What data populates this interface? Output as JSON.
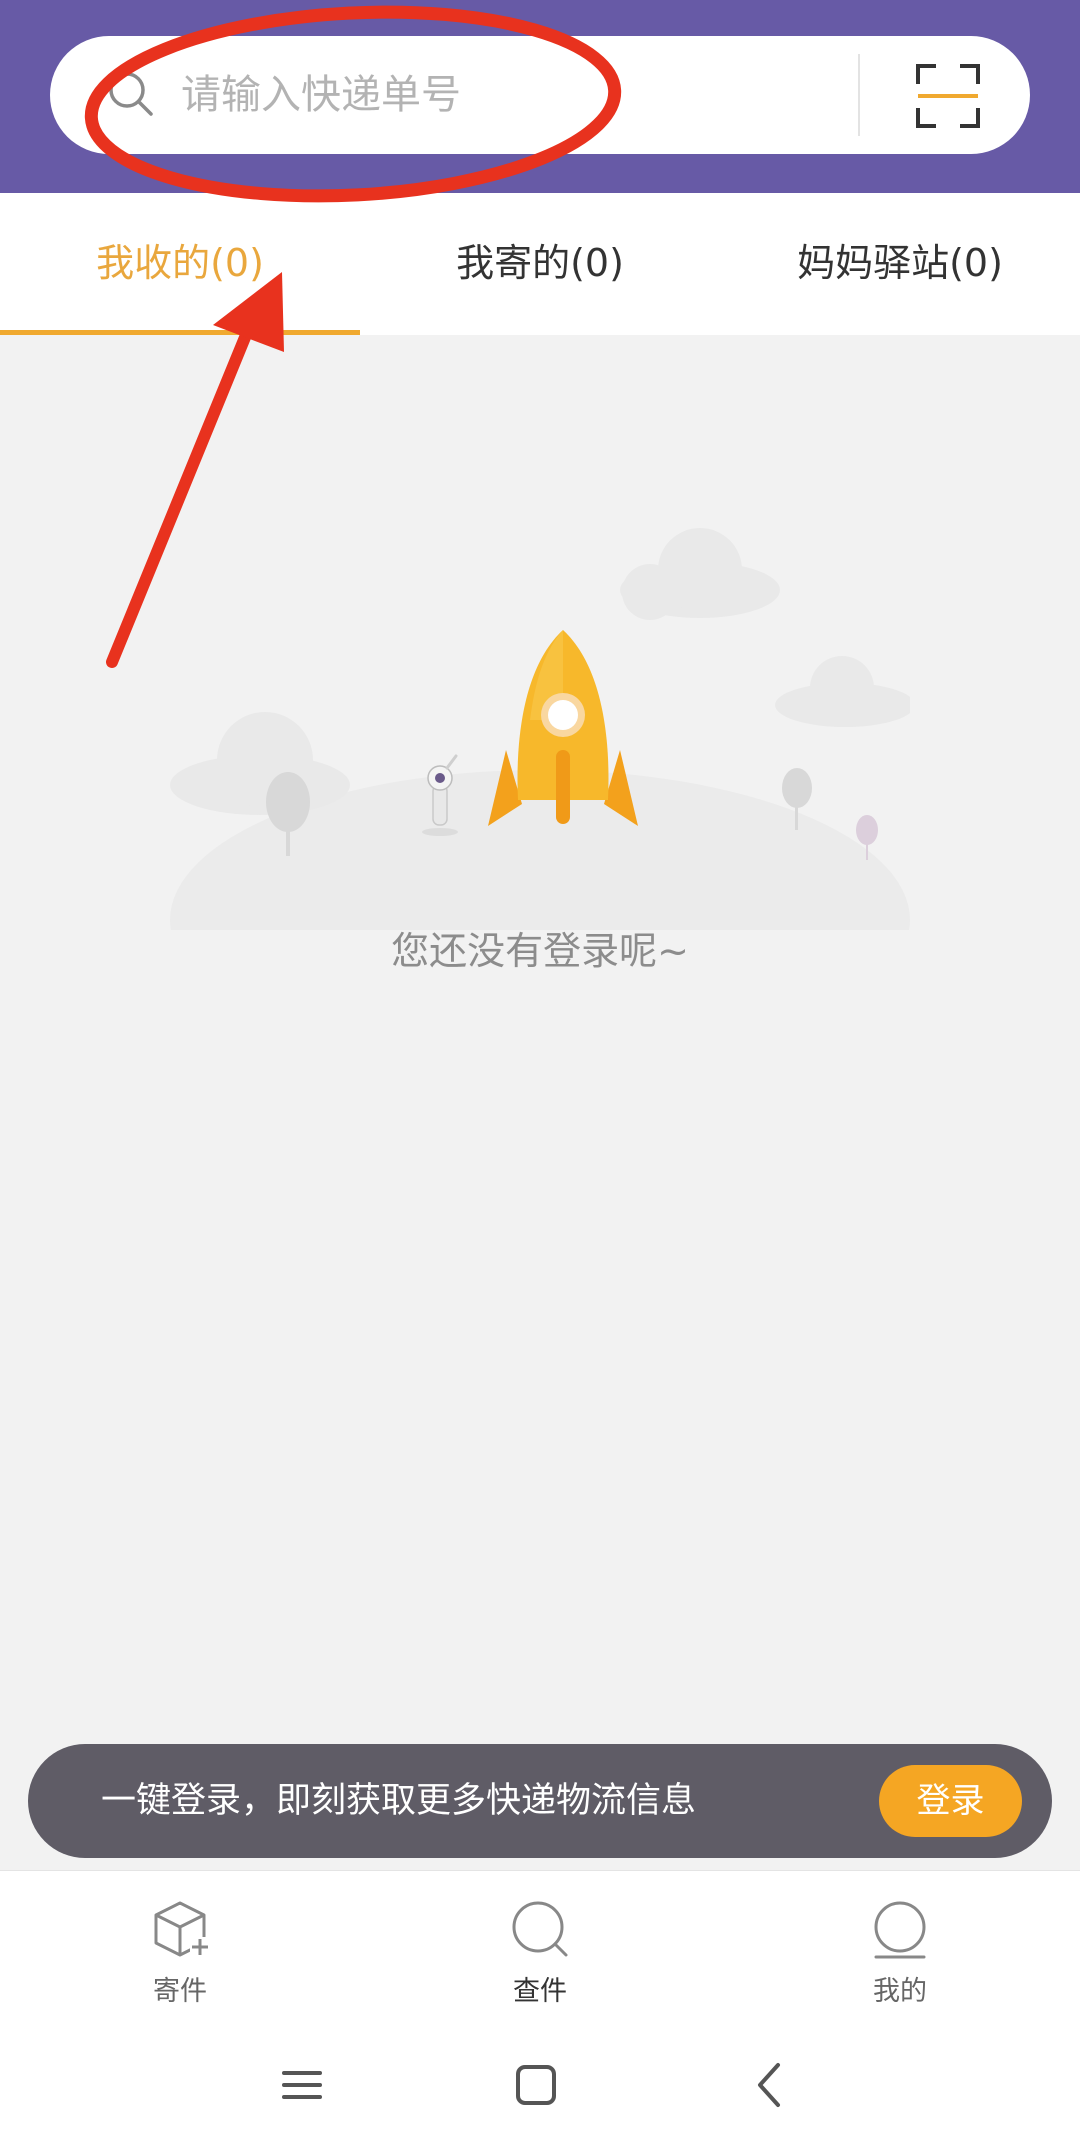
{
  "search": {
    "placeholder": "请输入快递单号",
    "search_icon": "search-icon",
    "scan_icon": "scan-icon"
  },
  "tabs": [
    {
      "label": "我收的(0)",
      "active": true
    },
    {
      "label": "我寄的(0)",
      "active": false
    },
    {
      "label": "妈妈驿站(0)",
      "active": false
    }
  ],
  "empty_state": {
    "message": "您还没有登录呢~",
    "illustration": "rocket-illustration"
  },
  "login_banner": {
    "text": "一键登录，即刻获取更多快递物流信息",
    "button_label": "登录"
  },
  "bottom_nav": [
    {
      "label": "寄件",
      "icon": "package-add-icon",
      "active": false
    },
    {
      "label": "查件",
      "icon": "search-icon",
      "active": true
    },
    {
      "label": "我的",
      "icon": "profile-icon",
      "active": false
    }
  ],
  "system_nav": {
    "menu_icon": "menu-icon",
    "home_icon": "home-icon",
    "back_icon": "back-icon"
  },
  "colors": {
    "header": "#675aa6",
    "accent": "#f0a92f",
    "background": "#f2f2f2",
    "annotation": "#e8321e"
  }
}
